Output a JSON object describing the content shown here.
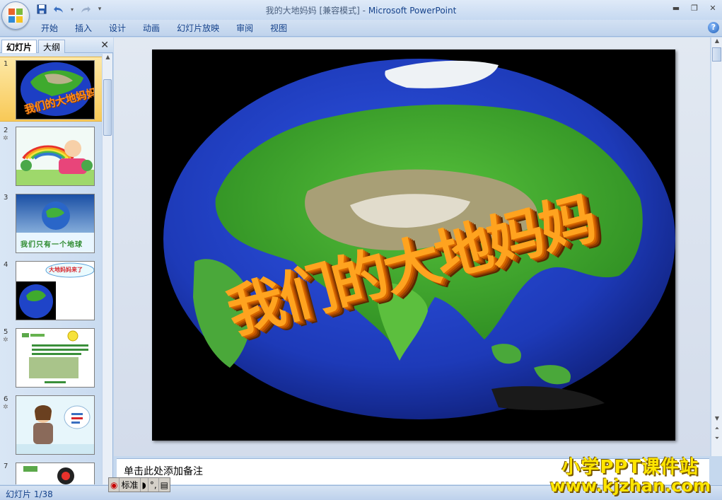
{
  "window": {
    "title": "我的大地妈妈 [兼容模式]",
    "separator": " - ",
    "app_name": "Microsoft PowerPoint"
  },
  "ribbon": {
    "tabs": [
      "开始",
      "插入",
      "设计",
      "动画",
      "幻灯片放映",
      "审阅",
      "视图"
    ]
  },
  "left_panel": {
    "tab_slides": "幻灯片",
    "tab_outline": "大纲",
    "thumbnails": [
      {
        "num": "1",
        "has_anim": false,
        "caption": "我们的大地妈妈"
      },
      {
        "num": "2",
        "has_anim": true,
        "caption": ""
      },
      {
        "num": "3",
        "has_anim": false,
        "caption": "我们只有一个地球"
      },
      {
        "num": "4",
        "has_anim": false,
        "caption": "大地妈妈来了"
      },
      {
        "num": "5",
        "has_anim": true,
        "caption": ""
      },
      {
        "num": "6",
        "has_anim": true,
        "caption": ""
      },
      {
        "num": "7",
        "has_anim": false,
        "caption": ""
      }
    ]
  },
  "slide": {
    "title_text": "我们的大地妈妈"
  },
  "notes": {
    "placeholder": "单击此处添加备注"
  },
  "status": {
    "slide_indicator": "幻灯片 1/38"
  },
  "ime": {
    "mode": "标准"
  },
  "watermark": {
    "line1": "小学PPT课件站",
    "line2": "www.kjzhan.com"
  },
  "colors": {
    "ocean": "#1d3fc4",
    "land": "#3faa2e",
    "title_fill": "#ff9a1a",
    "watermark": "#ffe600"
  }
}
